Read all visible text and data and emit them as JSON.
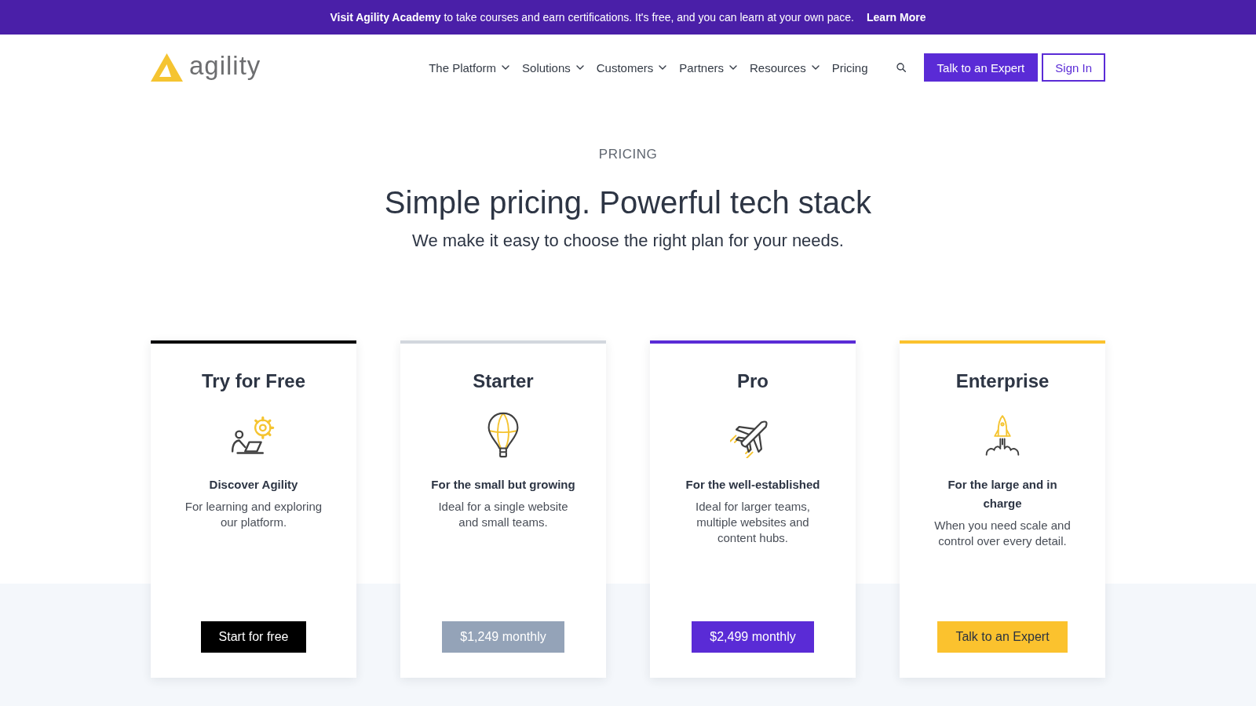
{
  "banner": {
    "message": "**Visit Agility Academy** to take courses and earn certifications. It's free, and you can learn at your own pace.",
    "link": "Learn More"
  },
  "header": {
    "logo_text": "agility",
    "nav": [
      {
        "label": "The Platform",
        "has_menu": true
      },
      {
        "label": "Solutions",
        "has_menu": true
      },
      {
        "label": "Customers",
        "has_menu": true
      },
      {
        "label": "Partners",
        "has_menu": true
      },
      {
        "label": "Resources",
        "has_menu": true
      },
      {
        "label": "Pricing",
        "has_menu": false
      }
    ],
    "buttons": [
      {
        "label": "Talk to an Expert",
        "kind": "primary"
      },
      {
        "label": "Sign In",
        "kind": "outline"
      }
    ]
  },
  "hero": {
    "eyebrow": "PRICING",
    "title": "Simple pricing. Powerful tech stack",
    "subtitle": "We make it easy to choose the right plan for your needs."
  },
  "plans": [
    {
      "name": "Try for Free",
      "color": "#000000",
      "tagline": "Discover Agility",
      "description": "For learning and exploring our platform.",
      "button": {
        "label": "Start for free",
        "color": "#000000"
      }
    },
    {
      "name": "Starter",
      "color": "#d2d7de",
      "tagline": "For the small but growing",
      "description": "Ideal for a single website and small teams.",
      "button": {
        "label": "$1,249 monthly",
        "color": "#94a3b8"
      }
    },
    {
      "name": "Pro",
      "color": "#5a2bd6",
      "tagline": "For the well-established",
      "description": "Ideal for larger teams, multiple websites and content hubs.",
      "button": {
        "label": "$2,499 monthly",
        "color": "#5a2bd6"
      }
    },
    {
      "name": "Enterprise",
      "color": "#fbc22e",
      "tagline": "For the large and in charge",
      "description": "When you need scale and control over every detail.",
      "button": {
        "label": "Talk to an Expert",
        "color": "#fbc22e"
      }
    }
  ]
}
